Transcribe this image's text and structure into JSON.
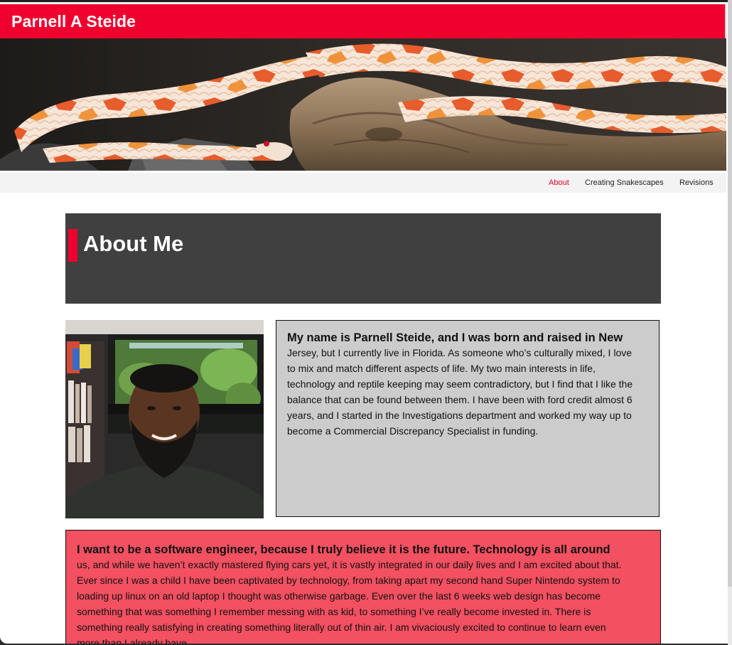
{
  "site": {
    "title": "Parnell A Steide"
  },
  "banner": {
    "alt": "Orange and white corn snake resting on driftwood"
  },
  "nav": {
    "items": [
      {
        "label": "About",
        "active": true
      },
      {
        "label": "Creating Snakescapes",
        "active": false
      },
      {
        "label": "Revisions",
        "active": false
      }
    ]
  },
  "hero": {
    "title": "About Me"
  },
  "bio": {
    "lead": "My name is Parnell Steide, and I was born and raised in New",
    "lines": [
      "Jersey, but I currently live in Florida. As someone who’s culturally mixed, I love",
      "to mix and match different aspects of life. My two main interests in life,",
      "technology and reptile keeping may seem contradictory, but I find that I like the",
      "balance that can be found between them. I have been with ford credit almost 6",
      "years, and I started in the Investigations department and worked my way up to",
      "become a Commercial Discrepancy Specialist in funding."
    ]
  },
  "goal": {
    "lead": "I want to be a software engineer, because I truly believe it is the future. Technology is all around",
    "lines": [
      "us, and while we haven’t exactly mastered flying cars yet, it is vastly integrated in our daily lives and I am excited about that.",
      "Ever since I was a child I have been captivated by technology, from taking apart my second hand Super Nintendo system to",
      "loading up linux on an old laptop I thought was otherwise garbage. Even over the last 6 weeks web design has become",
      "something that was something I remember messing with as kid, to something I’ve really become invested in. There is",
      "something really satisfying in creating something literally out of thin air. I am vivaciously excited to continue to learn even",
      "more than I already have."
    ]
  },
  "colors": {
    "brand_red": "#f0002e",
    "hero_gray": "#404040",
    "bio_gray": "#cccccc",
    "goal_pink": "#f35061"
  }
}
